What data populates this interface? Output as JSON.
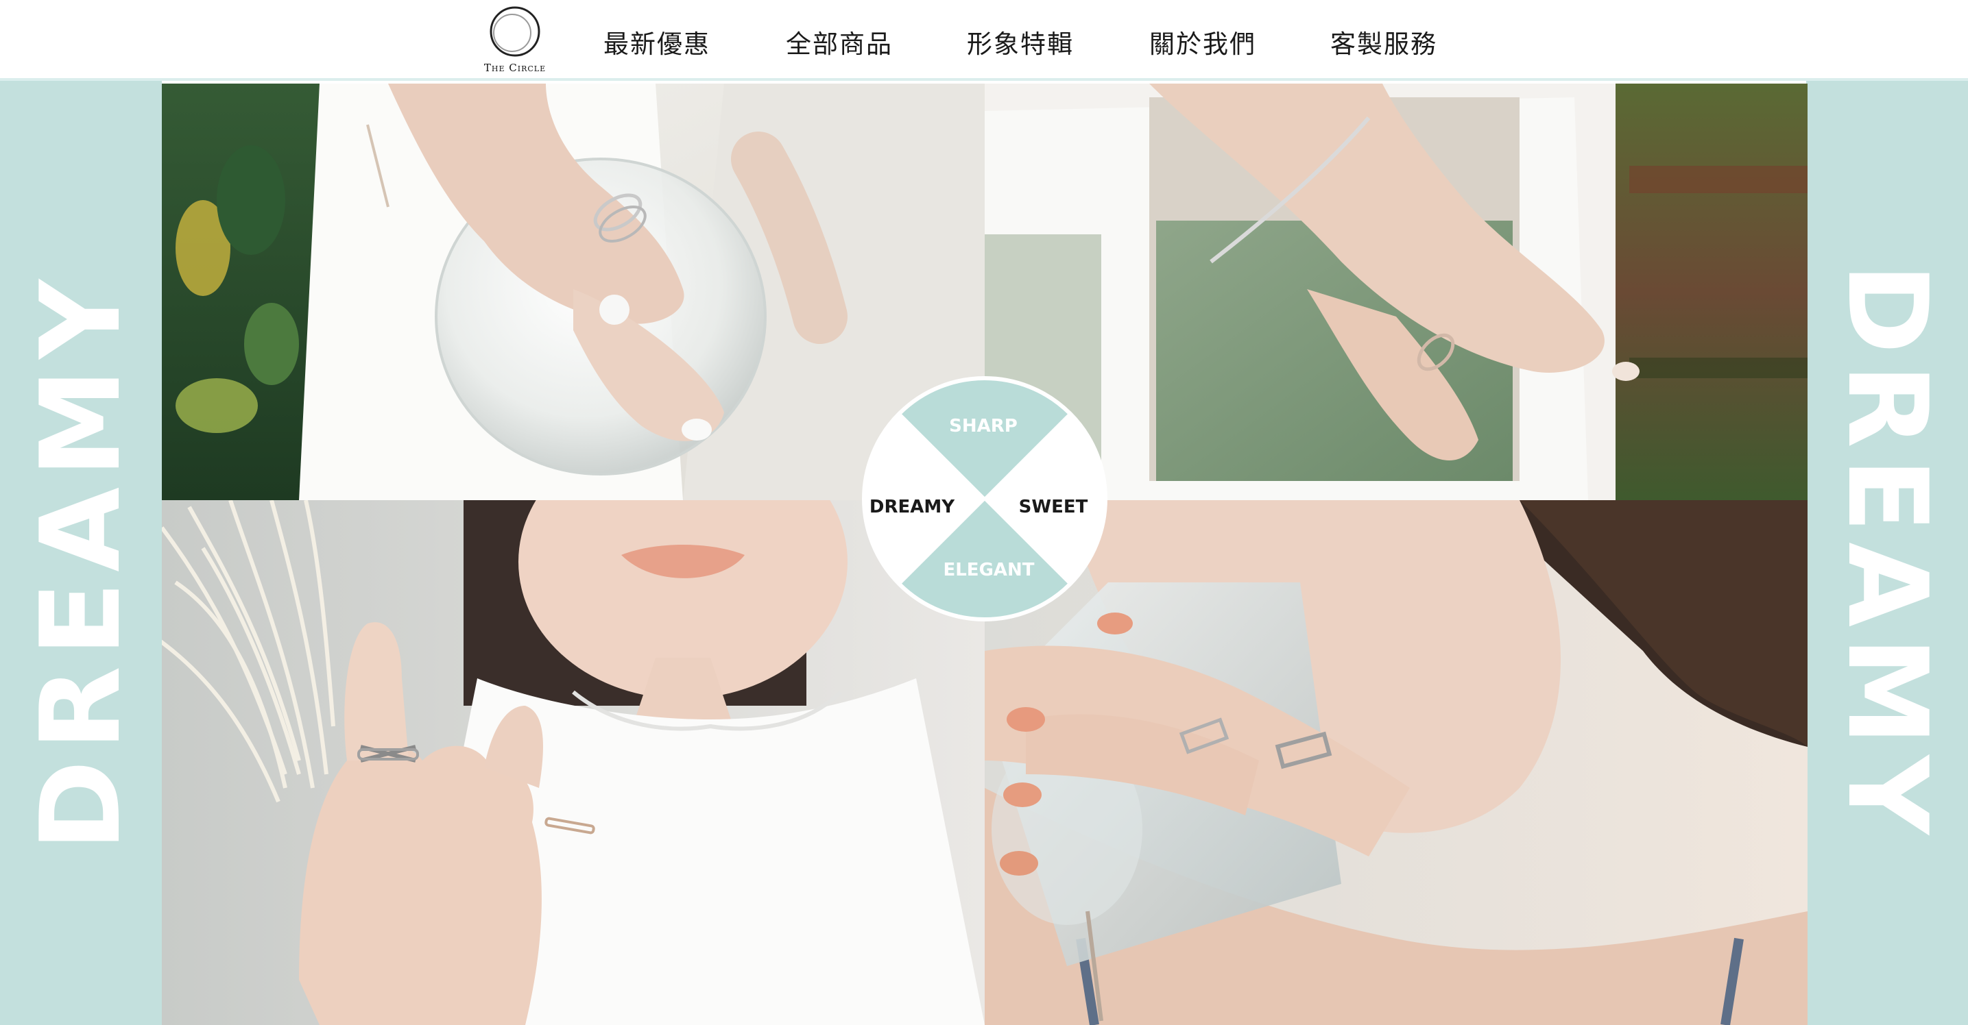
{
  "brand": {
    "logo_text": "The Circle"
  },
  "nav": {
    "items": [
      {
        "label": "最新優惠"
      },
      {
        "label": "全部商品"
      },
      {
        "label": "形象特輯"
      },
      {
        "label": "關於我們"
      },
      {
        "label": "客製服務"
      }
    ]
  },
  "banner": {
    "left_text": "DREAMY",
    "right_text": "DREAMY",
    "accent_color": "#c3e0dd"
  },
  "style_wheel": {
    "top": "SHARP",
    "right": "SWEET",
    "bottom": "ELEGANT",
    "left": "DREAMY",
    "filled_color": "#b9dcd8"
  },
  "photos": [
    {
      "name": "hand-with-rings-holding-glass"
    },
    {
      "name": "hand-with-bangle-and-ring"
    },
    {
      "name": "model-hand-with-crossed-ring"
    },
    {
      "name": "model-drinking-from-glass"
    }
  ]
}
